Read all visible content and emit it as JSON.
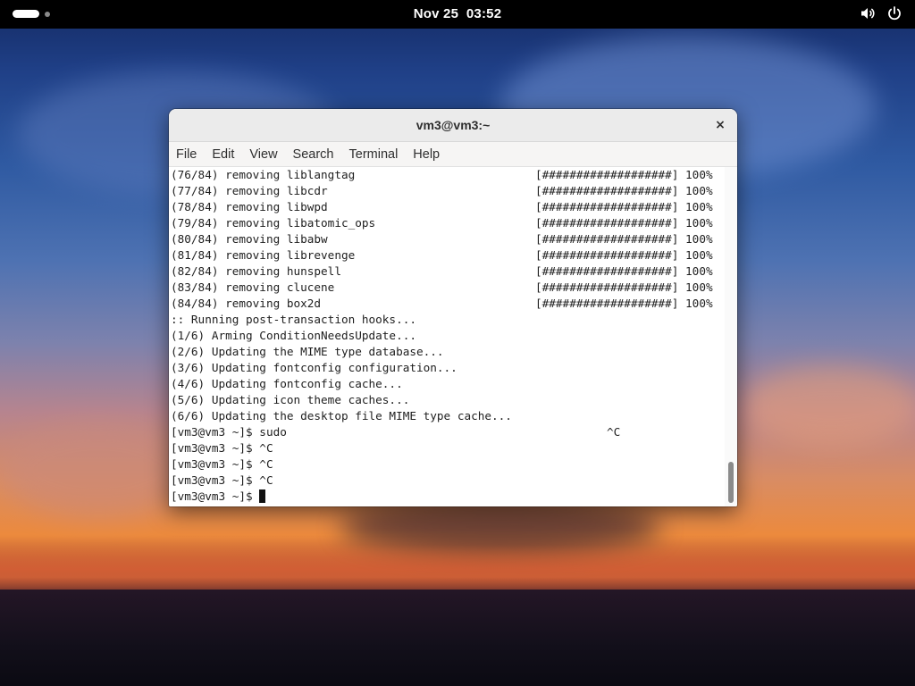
{
  "topbar": {
    "date": "Nov 25",
    "time": "03:52",
    "icons": [
      "activities-indicator",
      "volume-icon",
      "power-icon"
    ]
  },
  "window": {
    "title": "vm3@vm3:~",
    "close_label": "×",
    "menu": [
      "File",
      "Edit",
      "View",
      "Search",
      "Terminal",
      "Help"
    ]
  },
  "terminal": {
    "lines": [
      {
        "left": "(76/84) removing liblangtag",
        "right": "[###################] 100%"
      },
      {
        "left": "(77/84) removing libcdr",
        "right": "[###################] 100%"
      },
      {
        "left": "(78/84) removing libwpd",
        "right": "[###################] 100%"
      },
      {
        "left": "(79/84) removing libatomic_ops",
        "right": "[###################] 100%"
      },
      {
        "left": "(80/84) removing libabw",
        "right": "[###################] 100%"
      },
      {
        "left": "(81/84) removing librevenge",
        "right": "[###################] 100%"
      },
      {
        "left": "(82/84) removing hunspell",
        "right": "[###################] 100%"
      },
      {
        "left": "(83/84) removing clucene",
        "right": "[###################] 100%"
      },
      {
        "left": "(84/84) removing box2d",
        "right": "[###################] 100%"
      },
      {
        "left": ":: Running post-transaction hooks...",
        "right": ""
      },
      {
        "left": "(1/6) Arming ConditionNeedsUpdate...",
        "right": ""
      },
      {
        "left": "(2/6) Updating the MIME type database...",
        "right": ""
      },
      {
        "left": "(3/6) Updating fontconfig configuration...",
        "right": ""
      },
      {
        "left": "(4/6) Updating fontconfig cache...",
        "right": ""
      },
      {
        "left": "(5/6) Updating icon theme caches...",
        "right": ""
      },
      {
        "left": "(6/6) Updating the desktop file MIME type cache...",
        "right": ""
      },
      {
        "left": "[vm3@vm3 ~]$ sudo",
        "right": "^C",
        "right_offset_chars": 61
      },
      {
        "left": "[vm3@vm3 ~]$ ^C",
        "right": ""
      },
      {
        "left": "[vm3@vm3 ~]$ ^C",
        "right": ""
      },
      {
        "left": "[vm3@vm3 ~]$ ^C",
        "right": ""
      }
    ],
    "prompt": "[vm3@vm3 ~]$ "
  }
}
